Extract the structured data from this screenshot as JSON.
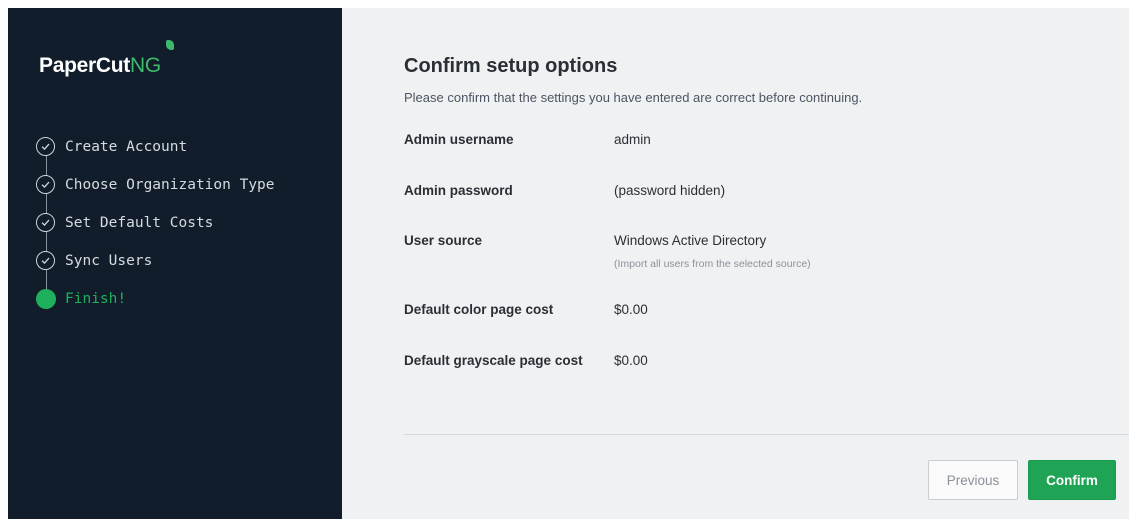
{
  "brand": {
    "name_main": "PaperCut",
    "name_suffix": "NG",
    "accent": "#3fb96b"
  },
  "steps": [
    {
      "label": "Create Account",
      "status": "done"
    },
    {
      "label": "Choose Organization Type",
      "status": "done"
    },
    {
      "label": "Set Default Costs",
      "status": "done"
    },
    {
      "label": "Sync Users",
      "status": "done"
    },
    {
      "label": "Finish!",
      "status": "current"
    }
  ],
  "main": {
    "title": "Confirm setup options",
    "subtitle": "Please confirm that the settings you have entered are correct before continuing.",
    "rows": [
      {
        "key": "Admin username",
        "value": "admin"
      },
      {
        "key": "Admin password",
        "value": "(password hidden)"
      },
      {
        "key": "User source",
        "value": "Windows Active Directory",
        "hint": "(Import all users from the selected source)"
      },
      {
        "key": "Default color page cost",
        "value": "$0.00"
      },
      {
        "key": "Default grayscale page cost",
        "value": "$0.00"
      }
    ],
    "buttons": {
      "previous": "Previous",
      "confirm": "Confirm"
    }
  },
  "colors": {
    "sidebar_bg": "#111d2a",
    "main_bg": "#f0f1f2",
    "success": "#1fa355"
  }
}
